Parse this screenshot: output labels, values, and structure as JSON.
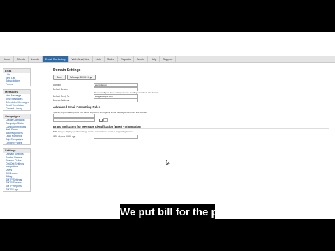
{
  "nav": [
    "Home",
    "Clients",
    "Leads",
    "Email Marketing",
    "Web Analytics",
    "Lists",
    "Sales",
    "Reports",
    "Admin",
    "Help",
    "Support"
  ],
  "sidebar": [
    {
      "title": "Lists",
      "links": [
        "Lists",
        "New List",
        "Subscriptions",
        "Forms"
      ]
    },
    {
      "title": "Messages",
      "links": [
        "New Message",
        "View Messages",
        "Scheduled Messages",
        "Email Templates",
        "Content Library"
      ]
    },
    {
      "title": "Campaigns",
      "links": [
        "Create Campaign",
        "Campaign Status",
        "Campaign Reports",
        "Web Forms",
        "Autoresponders",
        "Lead Nurturing",
        "Drip Campaigns",
        "Landing Pages"
      ]
    },
    {
      "title": "Settings",
      "links": [
        "Domain Settings",
        "Sender Names",
        "Custom Fields",
        "Opt-Out Settings",
        "Integrations",
        "Users",
        "API Access",
        "Billing",
        "SMTP Settings",
        "SMTP Servers",
        "SMTP Reports",
        "SMTP Logs"
      ]
    }
  ],
  "page": {
    "title": "Domain Settings",
    "buttons": [
      "Save",
      "Manage DKIM Keys"
    ],
    "fields": [
      {
        "label": "Domain",
        "value": "example.com"
      },
      {
        "label": "Default Sender",
        "value": ""
      },
      {
        "label": "Default Reply To",
        "value": "info@example.com"
      },
      {
        "label": "Bounce Address",
        "value": ""
      }
    ],
    "note": "Please configure these settings before sending email from this domain.",
    "sec1": "Advanced Email Formatting Rules",
    "sec1_desc": "Specify any formatting rules that will be applied to all outgoing email messages sent from this domain.",
    "rule_value": "",
    "sec2": "Brand Indicators for Message Identification (BIMI) - Information",
    "sec2_text": "BIMI lets you display your brand logo next to authenticated email in supporting inboxes.",
    "bimi_label": "URL of your BIMI Logo",
    "bimi_value": ""
  },
  "caption": "We put bill for the prefix"
}
